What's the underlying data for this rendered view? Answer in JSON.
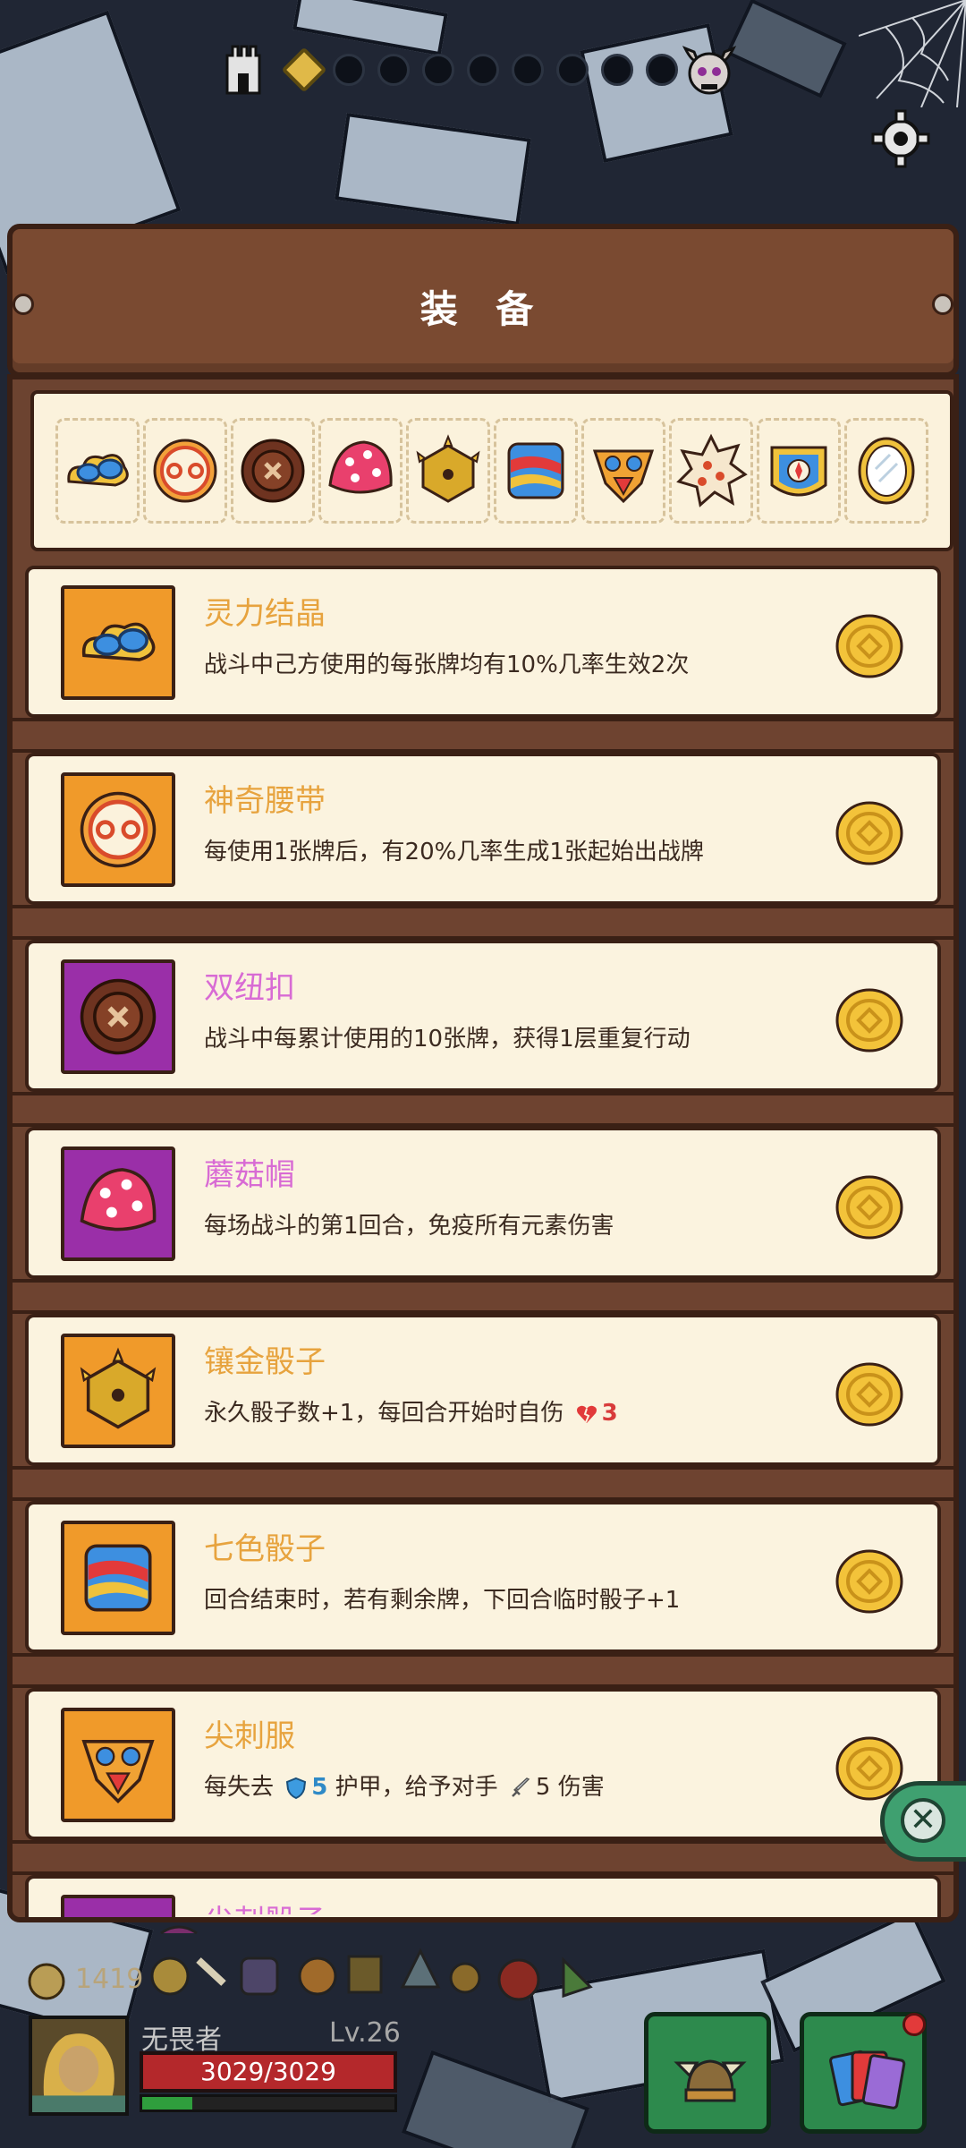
{
  "panel": {
    "title": "装 备"
  },
  "progress": {
    "total_nodes": 9,
    "current_index": 0
  },
  "colors": {
    "accent_gold": "#e7a33e",
    "pink": "#d86bd4",
    "orange_box": "#f09a2a",
    "purple_box": "#9a2fa8"
  },
  "strip_items": [
    {
      "icon": "spirit-crystal-icon"
    },
    {
      "icon": "magic-belt-icon"
    },
    {
      "icon": "double-button-icon"
    },
    {
      "icon": "mushroom-cap-icon"
    },
    {
      "icon": "gilded-dice-icon"
    },
    {
      "icon": "rainbow-dice-icon"
    },
    {
      "icon": "spike-armor-icon"
    },
    {
      "icon": "spike-dice-icon"
    },
    {
      "icon": "compass-armor-icon"
    },
    {
      "icon": "mirror-icon"
    }
  ],
  "items": [
    {
      "name": "灵力结晶",
      "desc": "战斗中己方使用的每张牌均有10%几率生效2次",
      "rarity": "orange"
    },
    {
      "name": "神奇腰带",
      "desc": "每使用1张牌后，有20%几率生成1张起始出战牌",
      "rarity": "orange"
    },
    {
      "name": "双纽扣",
      "desc": "战斗中每累计使用的10张牌，获得1层重复行动",
      "rarity": "purple"
    },
    {
      "name": "蘑菇帽",
      "desc": "每场战斗的第1回合，免疫所有元素伤害",
      "rarity": "purple"
    },
    {
      "name": "镶金骰子",
      "desc_a": "永久骰子数+1，每回合开始时自伤",
      "desc_num": "3",
      "rarity": "orange"
    },
    {
      "name": "七色骰子",
      "desc": "回合结束时，若有剩余牌，下回合临时骰子+1",
      "rarity": "orange"
    },
    {
      "name": "尖刺服",
      "desc_a": "每失去",
      "desc_num1": "5",
      "desc_b": "护甲，给予对手",
      "desc_num2": "5",
      "desc_c": "伤害",
      "rarity": "orange"
    },
    {
      "name": "尖刺骰子",
      "rarity": "purple"
    }
  ],
  "hud": {
    "gold": "1419",
    "hero_name": "无畏者",
    "level": "Lv.26",
    "hp": "3029/3029",
    "xp_fraction": 0.2
  }
}
